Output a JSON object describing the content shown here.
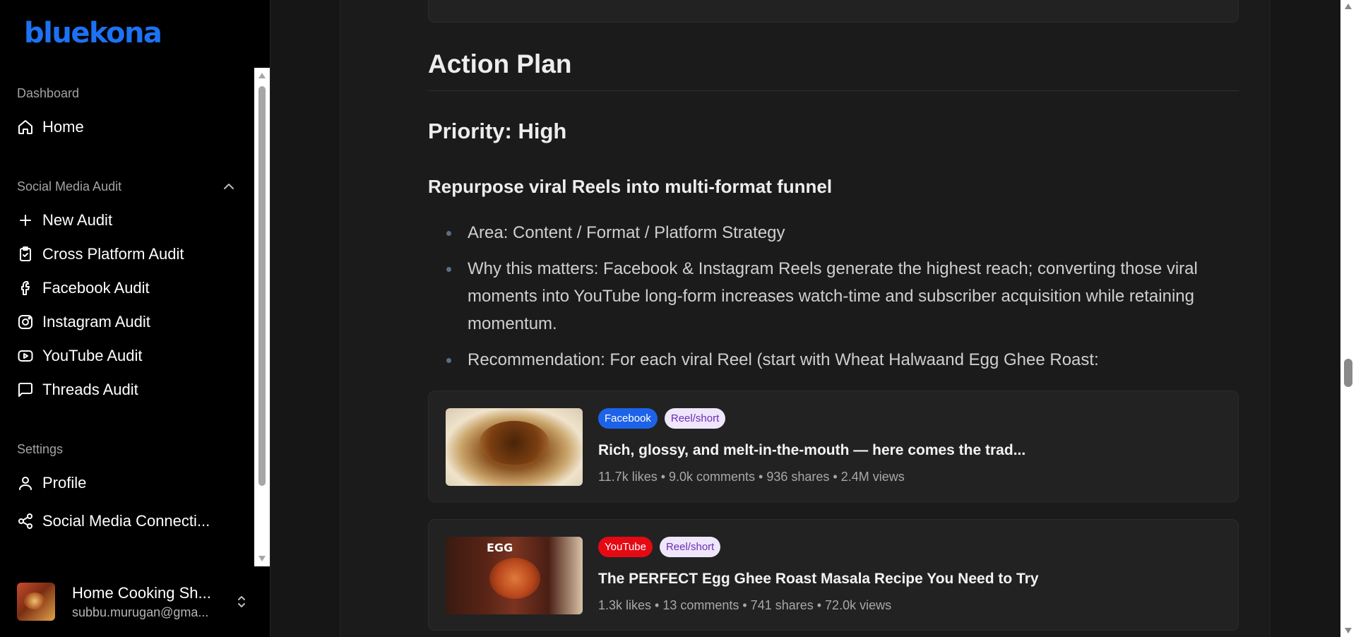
{
  "brand": {
    "logo": "bluekona"
  },
  "sidebar": {
    "sections": [
      {
        "label": "Dashboard"
      },
      {
        "label": "Social Media Audit"
      },
      {
        "label": "Settings"
      }
    ],
    "items": [
      {
        "label": "Home",
        "icon": "home-icon"
      },
      {
        "label": "New Audit",
        "icon": "plus-icon"
      },
      {
        "label": "Cross Platform Audit",
        "icon": "clipboard-check-icon"
      },
      {
        "label": "Facebook Audit",
        "icon": "facebook-icon"
      },
      {
        "label": "Instagram Audit",
        "icon": "instagram-icon"
      },
      {
        "label": "YouTube Audit",
        "icon": "youtube-icon"
      },
      {
        "label": "Threads Audit",
        "icon": "message-square-icon"
      },
      {
        "label": "Profile",
        "icon": "user-icon"
      },
      {
        "label": "Social Media Connecti...",
        "icon": "share-icon"
      }
    ]
  },
  "account": {
    "name": "Home Cooking Sh...",
    "email": "subbu.murugan@gma..."
  },
  "main": {
    "heading": "Action Plan",
    "priority": "Priority: High",
    "subheading": "Repurpose viral Reels into multi-format funnel",
    "bullets": [
      "Area: Content / Format / Platform Strategy",
      "Why this matters: Facebook & Instagram Reels generate the highest reach; converting those viral moments into YouTube long-form increases watch-time and subscriber acquisition while retaining momentum.",
      "Recommendation: For each viral Reel (start with Wheat Halwaand Egg Ghee Roast:"
    ],
    "posts": [
      {
        "platform": "Facebook",
        "type": "Reel/short",
        "title": "Rich, glossy, and melt-in-the-mouth — here comes the trad...",
        "stats": "11.7k likes • 9.0k comments • 936 shares • 2.4M views",
        "thumb_text": ""
      },
      {
        "platform": "YouTube",
        "type": "Reel/short",
        "title": "The PERFECT Egg Ghee Roast Masala Recipe You Need to Try",
        "stats": "1.3k likes • 13 comments • 741 shares • 72.0k views",
        "thumb_text": "EGG"
      }
    ]
  },
  "colors": {
    "brand": "#1d72f3",
    "facebook_badge": "#1d63ea",
    "youtube_badge": "#e50914",
    "type_badge_bg": "#efe6fb",
    "type_badge_text": "#6a2fb5"
  }
}
